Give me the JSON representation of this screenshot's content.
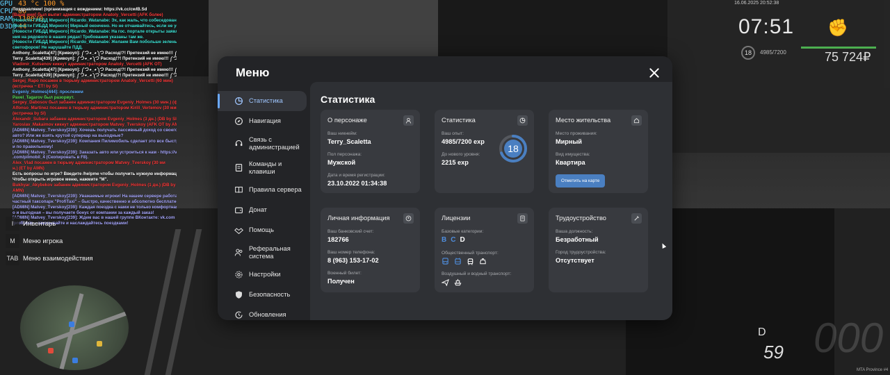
{
  "hud": {
    "fps": [
      {
        "k": "GPU",
        "v": "43 °c  100 %"
      },
      {
        "k": "CPU",
        "v": "66"
      },
      {
        "k": "RAM",
        "v": "1100/0"
      },
      {
        "k": "D3D9",
        "v": "44"
      }
    ],
    "datetime": "16.06.2025 20:52:38",
    "clock": "07:51",
    "level": "18",
    "exp": "4985/7200",
    "money": "75 724₽",
    "gear": "D",
    "speed": "59",
    "speed_big": "000",
    "watermark": "MTA Province #4"
  },
  "chat": [
    {
      "t": "Поздравляем! (организация с вождением: https://vk.cc/cwlB.Sd",
      "c": "c-white"
    },
    {
      "t": "[Ваше имя] был выпит администратором Anatoly_Vercetti (AFK более)",
      "c": "c-red"
    },
    {
      "t": "[Новости ГИБДД Мирного] Ricardo_Watanabe: Эх, как жаль, что собеседование",
      "c": "c-cyan"
    },
    {
      "t": "[Новости ГИБДД Мирного] Мирный окончено. Но не отчаивайтесь, если не успели!",
      "c": "c-cyan"
    },
    {
      "t": "[Новости ГИБДД Мирного] Ricardo_Watanabe: На гос. портале открыты заявле",
      "c": "c-cyan"
    },
    {
      "t": "ния на рядового в наших рядах! Требования указаны там же.",
      "c": "c-cyan"
    },
    {
      "t": "[Новости ГИБДД Мирного] Ricardo_Watanabe: Желаем Вам побольше зеленых",
      "c": "c-cyan"
    },
    {
      "t": " светофоров! Не нарушайте ПДД.",
      "c": "c-cyan"
    },
    {
      "t": "Anthony_Scaletta[47] [Кривоуп]: ༼つ◕_◕༽つ Расход!?! Претензий не имею!!! ༼つ◕_◕",
      "c": "c-white"
    },
    {
      "t": "Terry_Scaletta[439] [Кривоуп]: ༼つ◕_◕༽つ Расход!?! Претензий не имею!!! ༼つ◕_◕",
      "c": "c-white"
    },
    {
      "t": "Vladimir_Kutsenov кикнут администратором Anatoly_Vercetti (AFK OT)",
      "c": "c-red"
    },
    {
      "t": "Anthony_Scaletta[47] [Кривоуп]: ༼つ◕_◕༽つ Расход!?! Претензий не имею!!! ༼つ◕_◕",
      "c": "c-white"
    },
    {
      "t": "Terry_Scaletta[439] [Кривоуп]: ༼つ◕_◕༽つ Расход!?! Претензий не имею!!! ༼つ◕_◕",
      "c": "c-white"
    },
    {
      "t": "Sergej_Rapo посажен в тюрьму администратором Anatoly_Vercetti (60 мин)",
      "c": "c-red"
    },
    {
      "t": "(встречка ~ ET! by SI)",
      "c": "c-red"
    },
    {
      "t": "Evgeniy_Holmes[444]: прослежем",
      "c": "c-blue"
    },
    {
      "t": "Pavel_Tagarov был разорвут.",
      "c": "c-green"
    },
    {
      "t": "Sergey_Dabosov был забанен администратором Evgeniy_Holmes (30 мин.) (флуд)",
      "c": "c-red"
    },
    {
      "t": "Alfonso_Martinez посажен в тюрьму администратором Kirill_Vertemov (30 мин.)",
      "c": "c-red"
    },
    {
      "t": "(встречка by SI)",
      "c": "c-red"
    },
    {
      "t": "Alexandr_Subaru забанен администратором Evgeniy_Holmes (3 дн.) (DB by SI)",
      "c": "c-red"
    },
    {
      "t": "Yaroslav_Makaimov кикнут администратором Matvey_Tverskoy (AFK OT by AMN)",
      "c": "c-red"
    },
    {
      "t": "[ADMIN] Matvey_Tverskoy[239]: Хочешь получать пассивный доход со своего",
      "c": "c-violet"
    },
    {
      "t": " авто? Или же взять крутой суперкар на выходные?",
      "c": "c-violet"
    },
    {
      "t": "[ADMIN] Matvey_Tverskoy[239]: Компания Пилимобиль сделает это все быстро",
      "c": "c-violet"
    },
    {
      "t": " и по правильному!",
      "c": "c-violet"
    },
    {
      "t": "[ADMIN] Matvey_Tverskoy[239]: Заказать авто или устроиться к нам - https://vk",
      "c": "c-violet"
    },
    {
      "t": ".com/pilmobil_4 (Скопировать в F8).",
      "c": "c-violet"
    },
    {
      "t": "Alex_Vlad посажен в тюрьму администратором Matvey_Tverskoy (30 ми",
      "c": "c-red"
    },
    {
      "t": "н.) (ET by AMN)",
      "c": "c-red"
    },
    {
      "t": "Есть вопросы по игре? Введите /helpme чтобы получить нужную информацию.",
      "c": "c-white"
    },
    {
      "t": "Чтобы открыть игровое меню, нажмите \"M\".",
      "c": "c-white"
    },
    {
      "t": "Bukhyar_Akybekov забанен администратором Evgeniy_Holmes (1 дн.) (DB by",
      "c": "c-red"
    },
    {
      "t": " AMN)",
      "c": "c-red"
    },
    {
      "t": "[ADMIN] Matvey_Tverskoy[239]: Уважаемые игроки! На нашем сервере работает",
      "c": "c-violet"
    },
    {
      "t": " частный таксопарк \"ProfiTaxi\" – быстро, качественно и абсолютно бесплатно!",
      "c": "c-violet"
    },
    {
      "t": "[ADMIN] Matvey_Tverskoy[239]: Каждая поездка с нами не только комфортная, н",
      "c": "c-violet"
    },
    {
      "t": "о и выгодная – вы получаете бонус от компании за каждый заказ!",
      "c": "c-violet"
    },
    {
      "t": "[ADMIN] Matvey_Tverskoy[239]: Ждем вас в нашей группе ВКонтакте: vk.com",
      "c": "c-violet"
    },
    {
      "t": "/profitaxis – заказывайте и наслаждайтесь поездками!",
      "c": "c-violet"
    }
  ],
  "hints": [
    {
      "key": "I",
      "label": "Инвентарь"
    },
    {
      "key": "M",
      "label": "Меню игрока"
    },
    {
      "key": "TAB",
      "label": "Меню взаимодействия"
    }
  ],
  "menu": {
    "title": "Меню",
    "nav": [
      {
        "id": "stats",
        "icon": "chart-pie-icon",
        "label": "Статистика",
        "active": true
      },
      {
        "id": "navigation",
        "icon": "compass-icon",
        "label": "Навигация"
      },
      {
        "id": "admin",
        "icon": "headset-icon",
        "label": "Связь с администрацией"
      },
      {
        "id": "commands",
        "icon": "document-icon",
        "label": "Команды и клавиши"
      },
      {
        "id": "rules",
        "icon": "book-icon",
        "label": "Правила сервера"
      },
      {
        "id": "donate",
        "icon": "wallet-icon",
        "label": "Донат"
      },
      {
        "id": "help",
        "icon": "handshake-icon",
        "label": "Помощь"
      },
      {
        "id": "referral",
        "icon": "users-icon",
        "label": "Реферальная система"
      },
      {
        "id": "settings",
        "icon": "gear-icon",
        "label": "Настройки"
      },
      {
        "id": "security",
        "icon": "shield-icon",
        "label": "Безопасность"
      },
      {
        "id": "updates",
        "icon": "clock-refresh-icon",
        "label": "Обновления"
      }
    ],
    "content_title": "Статистика",
    "cards": {
      "about": {
        "title": "О персонаже",
        "nick_label": "Ваш никнейм:",
        "nick": "Terry_Scaletta",
        "gender_label": "Пол персонажа:",
        "gender": "Мужской",
        "reg_label": "Дата и время регистрации:",
        "reg": "23.10.2022 01:34:38"
      },
      "stats": {
        "title": "Статистика",
        "exp_label": "Ваш опыт:",
        "exp": "4985/7200 exp",
        "next_label": "До нового уровня:",
        "next": "2215 exp",
        "level": "18",
        "progress": 0.692
      },
      "residence": {
        "title": "Место жительства",
        "place_label": "Место проживания:",
        "place": "Мирный",
        "property_label": "Вид имущества:",
        "property": "Квартира",
        "map_button": "Отметить на карте"
      },
      "personal": {
        "title": "Личная информация",
        "bank_label": "Ваш банковский счет:",
        "bank": "182766",
        "phone_label": "Ваш номер телефона:",
        "phone": "8 (963) 153-17-02",
        "military_label": "Военный билет:",
        "military": "Получен"
      },
      "licenses": {
        "title": "Лицензии",
        "base_label": "Базовые категории:",
        "categories": [
          {
            "name": "B",
            "color": "#4f8ede"
          },
          {
            "name": "C",
            "color": "#4f8ede"
          },
          {
            "name": "D",
            "color": "#ffffff"
          }
        ],
        "public_label": "Общественный транспорт:",
        "air_label": "Воздушный и водный транспорт:"
      },
      "employment": {
        "title": "Трудоустройство",
        "position_label": "Ваша должность:",
        "position": "Безработный",
        "city_label": "Город трудоустройства:",
        "city": "Отсутствует"
      }
    }
  },
  "colors": {
    "accent": "#6aa9ff",
    "button": "#4a7fc1",
    "ring": "#4a7fc1"
  }
}
